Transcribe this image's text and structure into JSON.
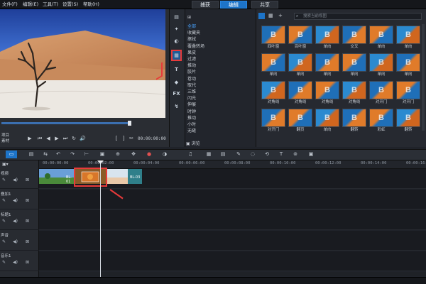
{
  "menu": {
    "file": "文件(F)",
    "edit": "编辑(E)",
    "tools": "工具(T)",
    "settings": "设置(S)",
    "help": "帮助(H)"
  },
  "tabs": {
    "capture": "捕获",
    "edit": "编辑",
    "share": "共享"
  },
  "player": {
    "mode_project": "项目",
    "mode_clip": "素材",
    "timecode": "00:00:00:00"
  },
  "library": {
    "search_placeholder": "搜索当前视图",
    "categories": [
      "全部",
      "收藏夹",
      "擦拭",
      "覆叠转场",
      "果皮",
      "过滤",
      "推动",
      "胶片",
      "卷动",
      "取代",
      "三维",
      "闪光",
      "伸展",
      "时钟",
      "推动",
      "小时",
      "无缝"
    ],
    "browse_label": "浏览",
    "thumbs": [
      [
        "四叶窗",
        "百叶窗",
        "单向",
        "交叉",
        "单向",
        "单向"
      ],
      [
        "单向",
        "单向",
        "单向",
        "单向",
        "单向",
        "单向"
      ],
      [
        "对角线",
        "对角线",
        "对角线",
        "对角线",
        "对开门",
        "对开门"
      ],
      [
        "对开门",
        "翻页",
        "单向",
        "翻转",
        "彩虹",
        "翻转"
      ]
    ]
  },
  "timeline": {
    "ruler": [
      "00:00:00:00",
      "00:00:02:00",
      "00:00:04:00",
      "00:00:06:00",
      "00:00:08:00",
      "00:00:10:00",
      "00:00:12:00",
      "00:00:14:00",
      "00:00:16:00"
    ],
    "tracks": [
      "视频",
      "叠加1",
      "标题1",
      "声音",
      "音乐1"
    ],
    "clip_label_left": "BL-01",
    "clip_label_right": "BL-03"
  },
  "colors": {
    "accent": "#1d74c9",
    "highlight": "#e83a3a",
    "selected_text": "#49a3ff"
  }
}
